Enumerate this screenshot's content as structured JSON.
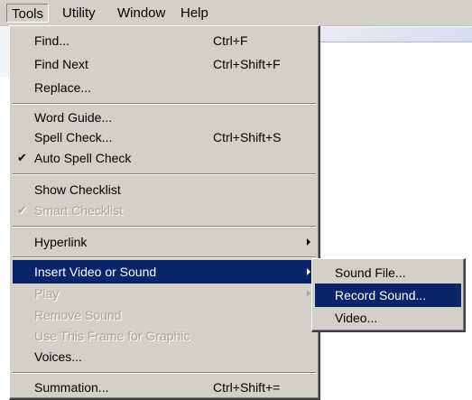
{
  "menubar": {
    "items": [
      "Tools",
      "Utility",
      "Window",
      "Help"
    ]
  },
  "tools_menu": {
    "items": [
      {
        "label": "Find...",
        "shortcut": "Ctrl+F"
      },
      {
        "label": "Find Next",
        "shortcut": "Ctrl+Shift+F"
      },
      {
        "label": "Replace...",
        "shortcut": ""
      },
      {
        "label": "Word Guide...",
        "shortcut": ""
      },
      {
        "label": "Spell Check...",
        "shortcut": "Ctrl+Shift+S"
      },
      {
        "label": "Auto Spell Check",
        "shortcut": "",
        "checked": true
      },
      {
        "label": "Show Checklist",
        "shortcut": ""
      },
      {
        "label": "Smart Checklist",
        "shortcut": "",
        "checked": true,
        "disabled": true
      },
      {
        "label": "Hyperlink",
        "shortcut": "",
        "submenu": true
      },
      {
        "label": "Insert Video or Sound",
        "shortcut": "",
        "submenu": true,
        "highlighted": true
      },
      {
        "label": "Play",
        "shortcut": "",
        "submenu": true,
        "disabled": true
      },
      {
        "label": "Remove Sound",
        "shortcut": "",
        "disabled": true
      },
      {
        "label": "Use This Frame for Graphic",
        "shortcut": "",
        "disabled": true
      },
      {
        "label": "Voices...",
        "shortcut": ""
      },
      {
        "label": "Summation...",
        "shortcut": "Ctrl+Shift+="
      }
    ],
    "check_glyph": "✔"
  },
  "submenu": {
    "items": [
      {
        "label": "Sound File..."
      },
      {
        "label": "Record Sound...",
        "highlighted": true
      },
      {
        "label": "Video..."
      }
    ]
  }
}
